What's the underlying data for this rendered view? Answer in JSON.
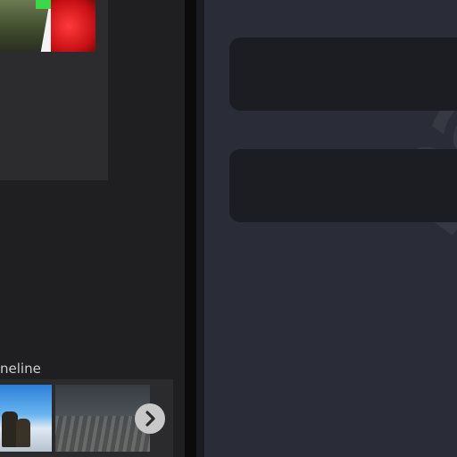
{
  "timeline": {
    "label": "neline"
  },
  "watermark": {
    "text": "par"
  },
  "icons": {
    "next": "chevron-right-icon"
  },
  "colors": {
    "left_bg": "#1f1f21",
    "right_bg": "#2a2d37",
    "field_bg": "#1b1d22",
    "divider": "#0b0b0c"
  }
}
